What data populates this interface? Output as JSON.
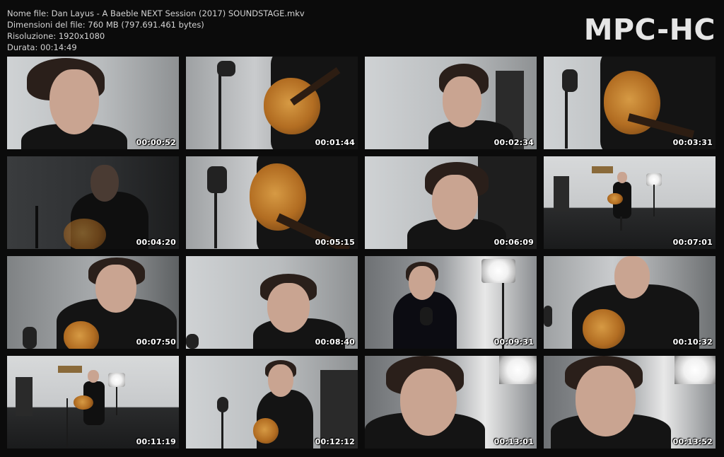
{
  "info": {
    "filename": "Nome file: Dan Layus - A Baeble NEXT Session (2017) SOUNDSTAGE.mkv",
    "filesize": "Dimensioni del file: 760 MB (797.691.461 bytes)",
    "resolution": "Risoluzione: 1920x1080",
    "duration": "Durata: 00:14:49"
  },
  "logo": "MPC-HC",
  "thumbnails": [
    {
      "time": "00:00:52"
    },
    {
      "time": "00:01:44"
    },
    {
      "time": "00:02:34"
    },
    {
      "time": "00:03:31"
    },
    {
      "time": "00:04:20"
    },
    {
      "time": "00:05:15"
    },
    {
      "time": "00:06:09"
    },
    {
      "time": "00:07:01"
    },
    {
      "time": "00:07:50"
    },
    {
      "time": "00:08:40"
    },
    {
      "time": "00:09:31"
    },
    {
      "time": "00:10:32"
    },
    {
      "time": "00:11:19"
    },
    {
      "time": "00:12:12"
    },
    {
      "time": "00:13:01"
    },
    {
      "time": "00:13:52"
    }
  ]
}
